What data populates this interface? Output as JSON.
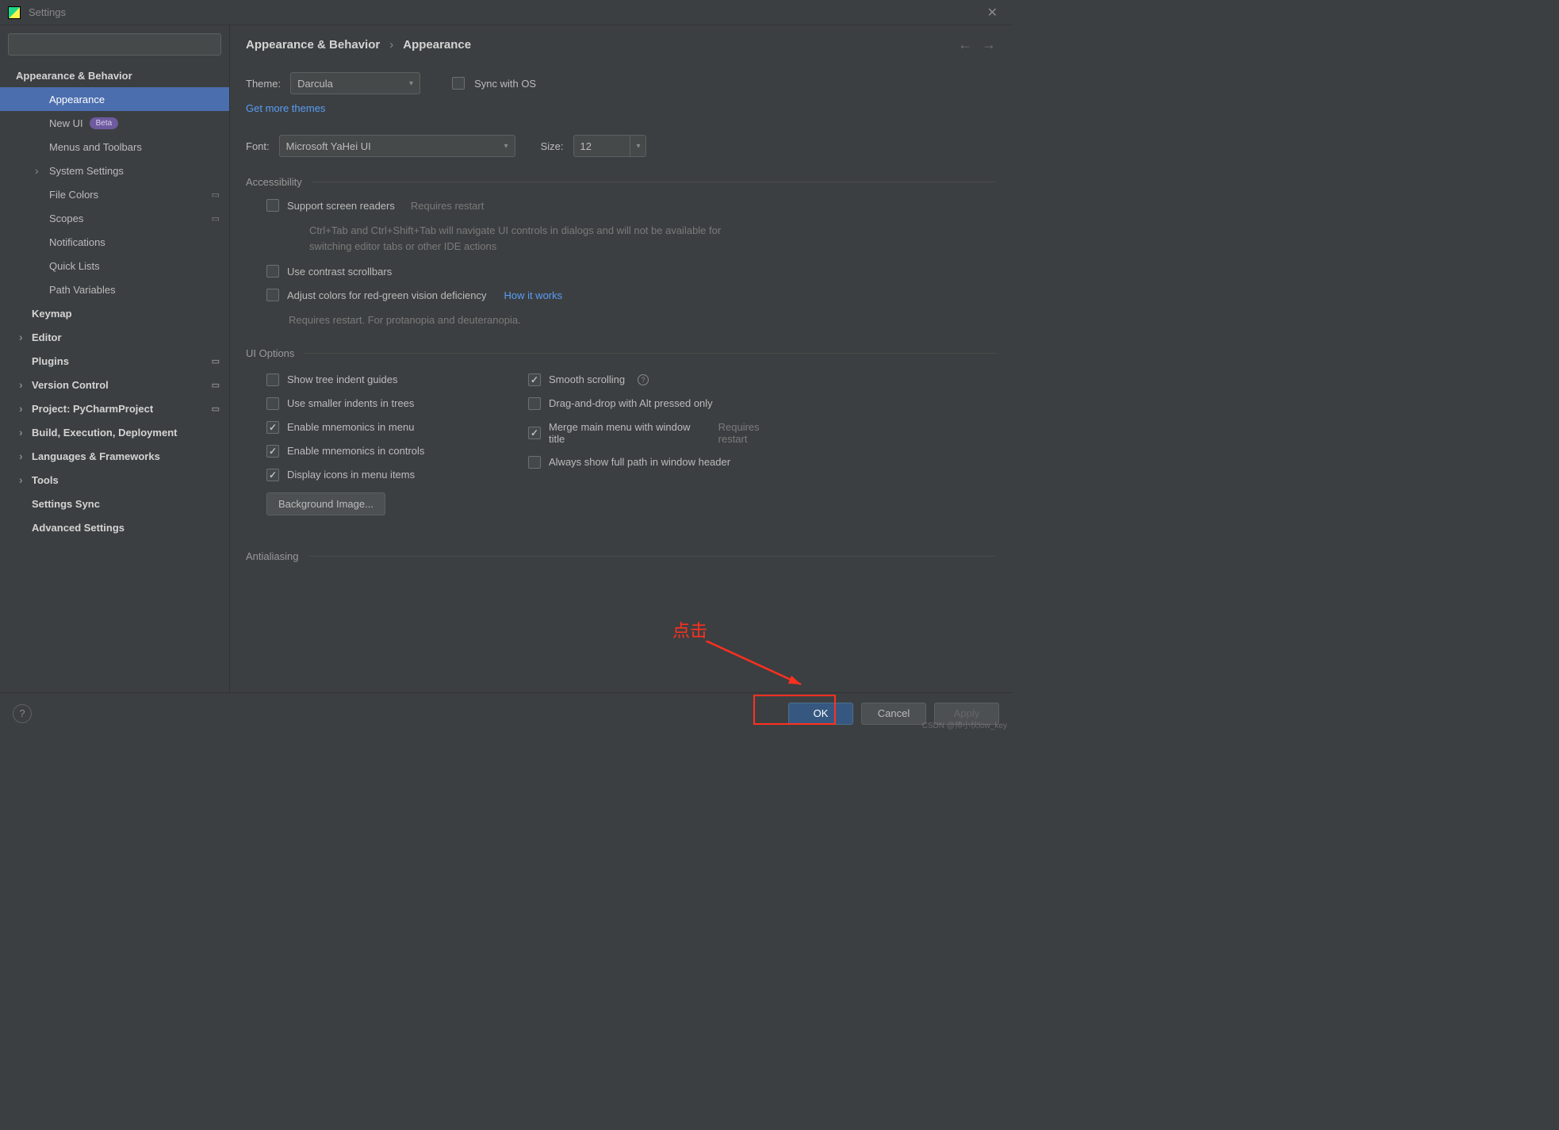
{
  "titlebar": {
    "title": "Settings"
  },
  "sidebar": {
    "items": [
      {
        "label": "Appearance & Behavior"
      },
      {
        "label": "Appearance"
      },
      {
        "label": "New UI",
        "badge": "Beta"
      },
      {
        "label": "Menus and Toolbars"
      },
      {
        "label": "System Settings"
      },
      {
        "label": "File Colors"
      },
      {
        "label": "Scopes"
      },
      {
        "label": "Notifications"
      },
      {
        "label": "Quick Lists"
      },
      {
        "label": "Path Variables"
      },
      {
        "label": "Keymap"
      },
      {
        "label": "Editor"
      },
      {
        "label": "Plugins"
      },
      {
        "label": "Version Control"
      },
      {
        "label": "Project: PyCharmProject"
      },
      {
        "label": "Build, Execution, Deployment"
      },
      {
        "label": "Languages & Frameworks"
      },
      {
        "label": "Tools"
      },
      {
        "label": "Settings Sync"
      },
      {
        "label": "Advanced Settings"
      }
    ]
  },
  "breadcrumb": {
    "a": "Appearance & Behavior",
    "sep": "›",
    "b": "Appearance"
  },
  "main": {
    "theme_label": "Theme:",
    "theme_value": "Darcula",
    "sync_os": "Sync with OS",
    "get_themes": "Get more themes",
    "font_label": "Font:",
    "font_value": "Microsoft YaHei UI",
    "size_label": "Size:",
    "size_value": "12",
    "accessibility_title": "Accessibility",
    "screen_readers": "Support screen readers",
    "requires_restart": "Requires restart",
    "screen_readers_hint": "Ctrl+Tab and Ctrl+Shift+Tab will navigate UI controls in dialogs and will not be available for switching editor tabs or other IDE actions",
    "contrast_scrollbars": "Use contrast scrollbars",
    "color_deficiency": "Adjust colors for red-green vision deficiency",
    "how_it_works": "How it works",
    "color_def_hint": "Requires restart. For protanopia and deuteranopia.",
    "ui_options_title": "UI Options",
    "tree_guides": "Show tree indent guides",
    "smooth_scroll": "Smooth scrolling",
    "smaller_indents": "Use smaller indents in trees",
    "drag_drop_alt": "Drag-and-drop with Alt pressed only",
    "mnemonics_menu": "Enable mnemonics in menu",
    "merge_menu": "Merge main menu with window title",
    "mnemonics_controls": "Enable mnemonics in controls",
    "full_path": "Always show full path in window header",
    "display_icons": "Display icons in menu items",
    "bg_image": "Background Image...",
    "antialiasing_title": "Antialiasing"
  },
  "footer": {
    "ok": "OK",
    "cancel": "Cancel",
    "apply": "Apply"
  },
  "annotation": {
    "text": "点击"
  },
  "watermark": "CSDN @帅小伙low_key"
}
